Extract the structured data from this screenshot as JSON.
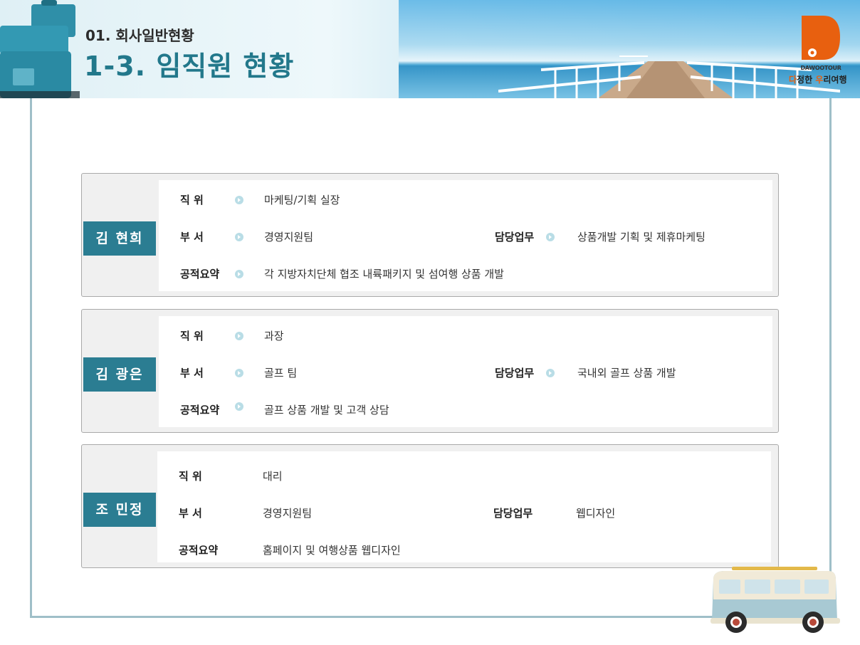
{
  "header": {
    "section": "01. 회사일반현황",
    "title": "1-3. 임직원 현황"
  },
  "logo": {
    "brand_en": "DAWOOTOUR",
    "slogan_a": "다",
    "slogan_b": "정한 ",
    "slogan_c": "우",
    "slogan_d": "리여행"
  },
  "employees": [
    {
      "name": "김 현희",
      "position_label": "직 위",
      "position": "마케팅/기획 실장",
      "dept_label": "부 서",
      "dept": "경영지원팀",
      "duty_label": "담당업무",
      "duty": "상품개발 기획 및 제휴마케팅",
      "summary_label": "공적요약",
      "summary": "각 지방자치단체 협조 내륙패키지 및 섬여행 상품 개발"
    },
    {
      "name": "김 광은",
      "position_label": "직 위",
      "position": "과장",
      "dept_label": "부 서",
      "dept": "골프 팀",
      "duty_label": "담당업무",
      "duty": "국내외 골프 상품 개발",
      "summary_label": "공적요약",
      "summary": "골프 상품 개발 및 고객 상담"
    },
    {
      "name": "조 민정",
      "position_label": "직 위",
      "position": "대리",
      "dept_label": "부 서",
      "dept": "경영지원팀",
      "duty_label": "담당업무",
      "duty": "웹디자인",
      "summary_label": "공적요약",
      "summary": "홈페이지 및 여행상품 웹디자인"
    }
  ],
  "colors": {
    "accent": "#2b7d92",
    "title": "#22788b",
    "logo_orange": "#e8600f",
    "frame": "#9fbfc8"
  }
}
